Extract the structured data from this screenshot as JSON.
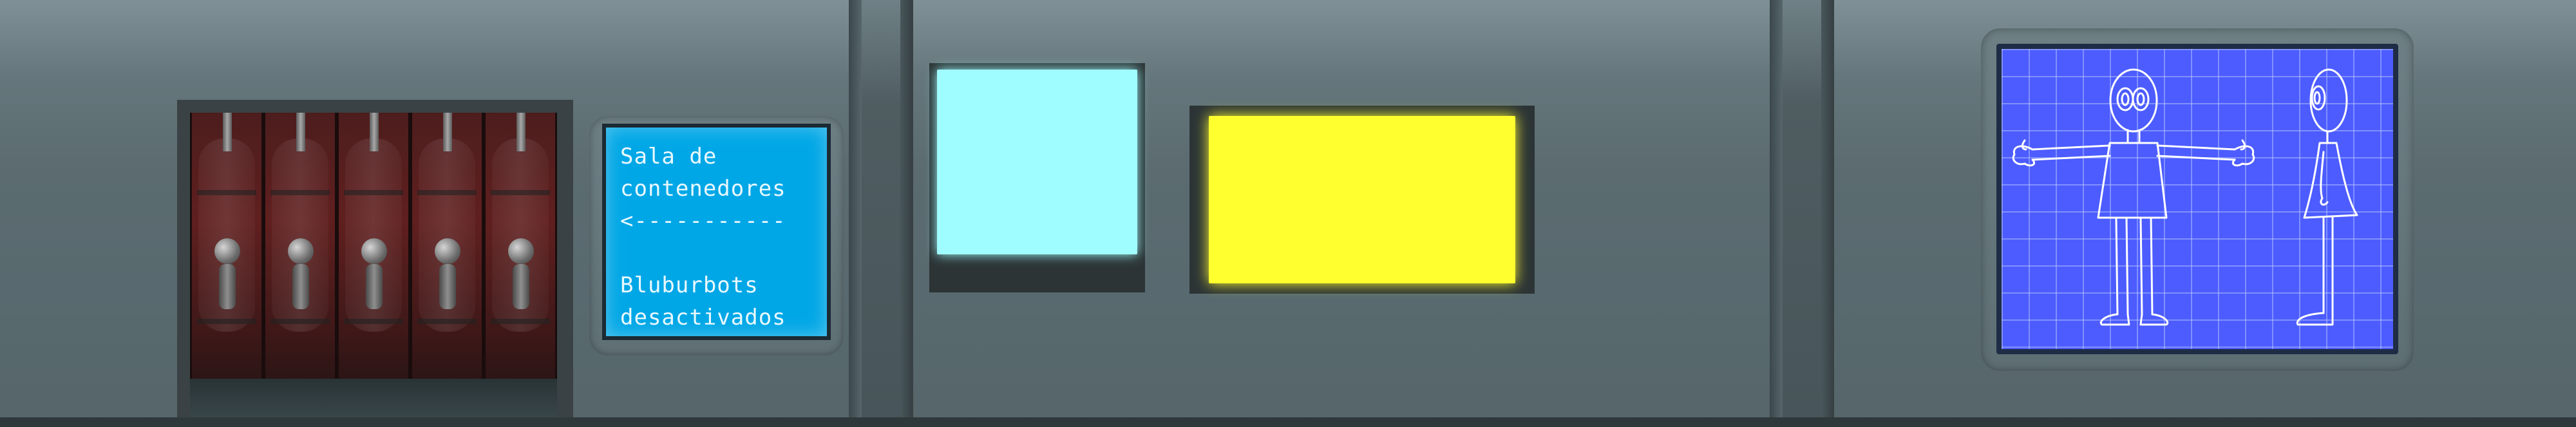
{
  "scene": {
    "sign": {
      "title_line1": "Sala de",
      "title_line2": "contenedores",
      "arrow": "<-----------",
      "subtitle_line1": "Bluburbots",
      "subtitle_line2": "desactivados"
    },
    "colors": {
      "sign_bg": "#00a7e6",
      "cyan_screen": "#9ffcff",
      "yellow_screen": "#fffe2e",
      "blueprint_bg": "#4c5cff",
      "wall": "#5b6b70"
    },
    "doorway": {
      "pods": 5
    },
    "blueprint_figures": [
      "front-view-figure",
      "side-view-figure"
    ]
  }
}
